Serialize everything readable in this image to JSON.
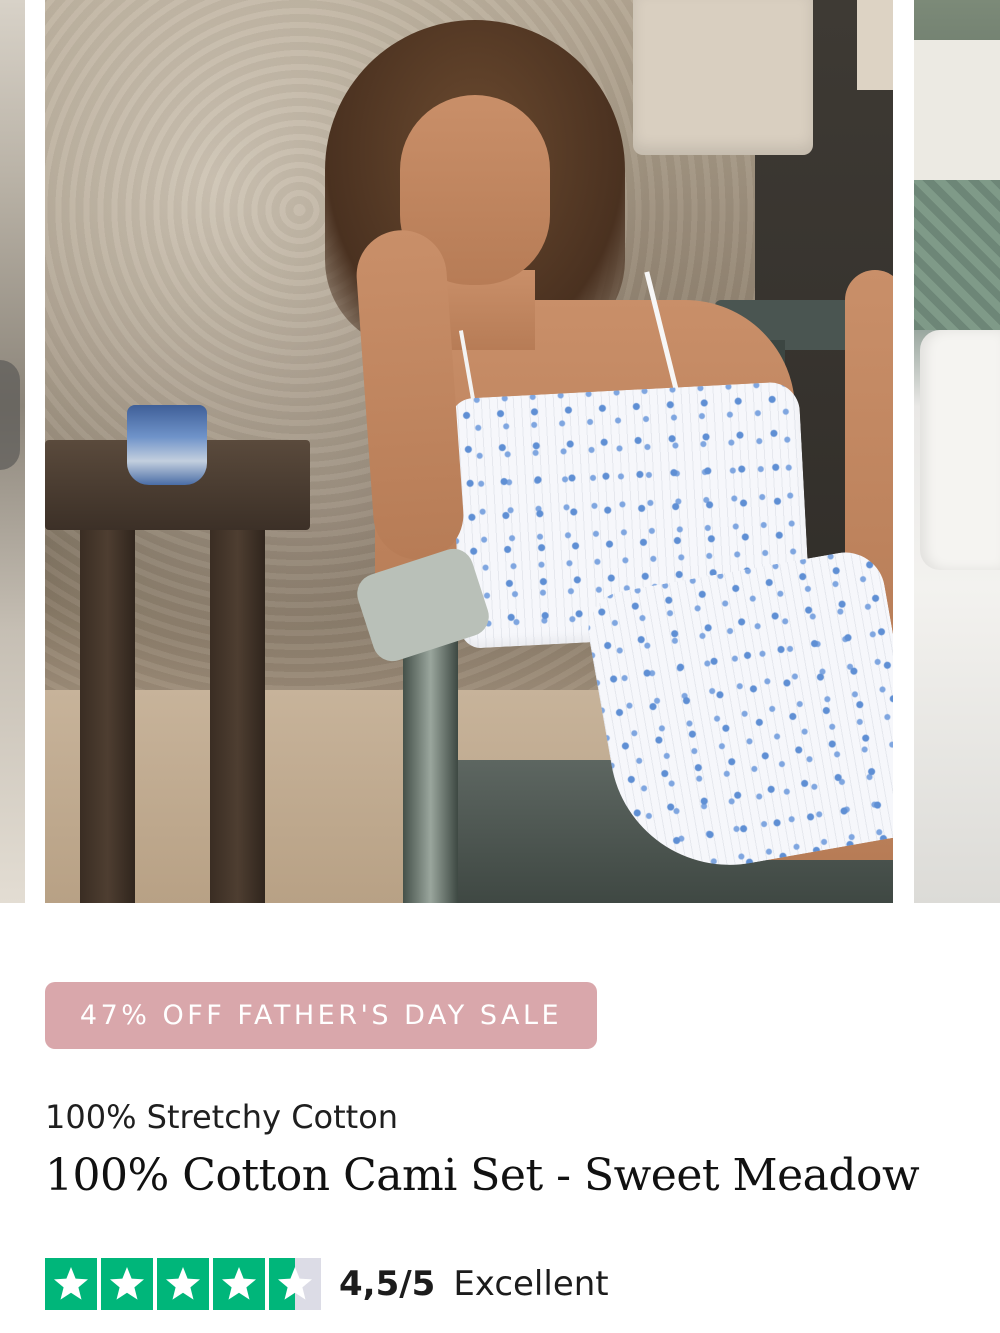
{
  "gallery": {
    "images": [
      "product-photo-prev",
      "product-photo-main",
      "product-photo-next"
    ]
  },
  "promo": {
    "badge_label": "47% OFF FATHER'S DAY SALE",
    "badge_color": "#d9a7ab"
  },
  "product": {
    "subtitle": "100% Stretchy Cotton",
    "title": "100% Cotton Cami Set - Sweet Meadow"
  },
  "rating": {
    "score": 4.5,
    "max": 5,
    "value_text": "4,5/5",
    "label": "Excellent",
    "star_color": "#00b67a",
    "empty_color": "#dcdce6",
    "icon": "star-icon"
  }
}
